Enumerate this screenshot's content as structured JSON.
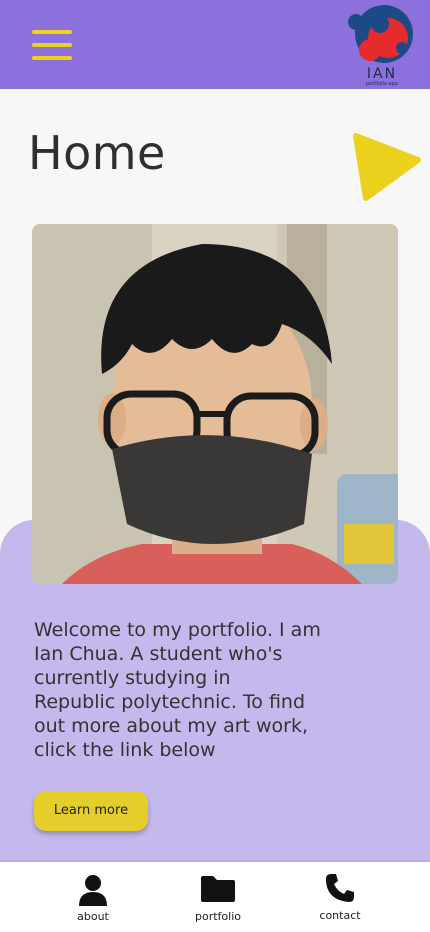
{
  "header": {
    "menu_icon": "hamburger-menu-icon",
    "logo": {
      "text": "IAN",
      "subtext": "portfolio app"
    }
  },
  "page": {
    "title": "Home",
    "next_icon": "play-triangle-icon"
  },
  "profile_photo": {
    "alt": "Photo of Ian Chua"
  },
  "welcome": {
    "text": "Welcome to my portfolio. I am\nIan Chua. A student who's\ncurrently studying in\n Republic polytechnic. To find\nout more about my art work,\nclick the link below"
  },
  "cta": {
    "label": "Learn more"
  },
  "bottom_nav": {
    "items": [
      {
        "label": "about",
        "icon": "person-icon"
      },
      {
        "label": "portfolio",
        "icon": "folder-icon"
      },
      {
        "label": "contact",
        "icon": "phone-icon"
      }
    ]
  },
  "colors": {
    "header": "#8c70db",
    "accent_yellow": "#ecd21c",
    "panel": "#c4b8ec",
    "logo_red": "#e52b2b",
    "logo_navy": "#1d4a86"
  }
}
